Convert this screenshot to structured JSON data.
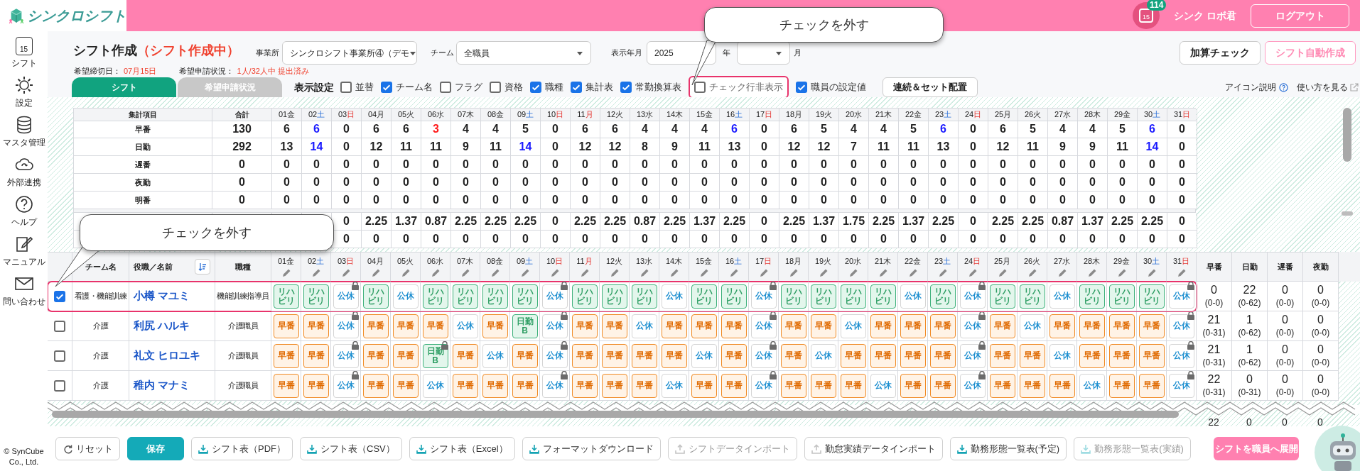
{
  "header": {
    "logo": "シンクロシフト",
    "calendar_day": "15",
    "badge": "114",
    "user": "シンク ロボ君",
    "logout": "ログアウト"
  },
  "sidebar": {
    "items": [
      {
        "label": "シフト",
        "icon_text": "15"
      },
      {
        "label": "設定"
      },
      {
        "label": "マスタ管理"
      },
      {
        "label": "外部連携"
      },
      {
        "label": "ヘルプ"
      },
      {
        "label": "マニュアル"
      },
      {
        "label": "問い合わせ"
      }
    ],
    "copyright": "© SynCube Co., Ltd."
  },
  "title": "シフト作成",
  "status": "（シフト作成中）",
  "filters": {
    "office_label": "事業所",
    "office": "シンクロシフト事業所④（デモ",
    "team_label": "チーム",
    "team": "全職員",
    "period_label": "表示年月",
    "year": "2025",
    "year_unit": "年",
    "month_unit": "月"
  },
  "actions": [
    "加算チェック",
    "シフト自動作成"
  ],
  "deadline": {
    "label": "希望締切日：",
    "value": "07月15日",
    "status_label": "希望申請状況：",
    "status": "1人/32人中 提出済み"
  },
  "tabs": [
    {
      "label": "シフト",
      "selected": true
    },
    {
      "label": "希望申請状況",
      "selected": false
    }
  ],
  "display_settings": {
    "label": "表示設定",
    "options": [
      {
        "label": "並替",
        "checked": false,
        "highlighted": false
      },
      {
        "label": "チーム名",
        "checked": true,
        "highlighted": false
      },
      {
        "label": "フラグ",
        "checked": false,
        "highlighted": false
      },
      {
        "label": "資格",
        "checked": false,
        "highlighted": false
      },
      {
        "label": "職種",
        "checked": true,
        "highlighted": false
      },
      {
        "label": "集計表",
        "checked": true,
        "highlighted": false
      },
      {
        "label": "常勤換算表",
        "checked": true,
        "highlighted": false
      },
      {
        "label": "チェック行非表示",
        "checked": false,
        "highlighted": true
      },
      {
        "label": "職員の設定値",
        "checked": true,
        "highlighted": false
      }
    ],
    "button": "連続＆セット配置"
  },
  "links": [
    "アイコン説明",
    "使い方を見る"
  ],
  "summary": {
    "label_header": "集計項目",
    "total_header": "合計",
    "days": [
      {
        "day": "01",
        "dow": "金",
        "kind": "weekday"
      },
      {
        "day": "02",
        "dow": "土",
        "kind": "sat"
      },
      {
        "day": "03",
        "dow": "日",
        "kind": "sun"
      },
      {
        "day": "04",
        "dow": "月",
        "kind": "weekday"
      },
      {
        "day": "05",
        "dow": "火",
        "kind": "weekday"
      },
      {
        "day": "06",
        "dow": "水",
        "kind": "weekday"
      },
      {
        "day": "07",
        "dow": "木",
        "kind": "weekday"
      },
      {
        "day": "08",
        "dow": "金",
        "kind": "weekday"
      },
      {
        "day": "09",
        "dow": "土",
        "kind": "sat"
      },
      {
        "day": "10",
        "dow": "日",
        "kind": "sun"
      },
      {
        "day": "11",
        "dow": "月",
        "kind": "holiday"
      },
      {
        "day": "12",
        "dow": "火",
        "kind": "weekday"
      },
      {
        "day": "13",
        "dow": "水",
        "kind": "weekday"
      },
      {
        "day": "14",
        "dow": "木",
        "kind": "weekday"
      },
      {
        "day": "15",
        "dow": "金",
        "kind": "weekday"
      },
      {
        "day": "16",
        "dow": "土",
        "kind": "sat"
      },
      {
        "day": "17",
        "dow": "日",
        "kind": "sun"
      },
      {
        "day": "18",
        "dow": "月",
        "kind": "weekday"
      },
      {
        "day": "19",
        "dow": "火",
        "kind": "weekday"
      },
      {
        "day": "20",
        "dow": "水",
        "kind": "weekday"
      },
      {
        "day": "21",
        "dow": "木",
        "kind": "weekday"
      },
      {
        "day": "22",
        "dow": "金",
        "kind": "weekday"
      },
      {
        "day": "23",
        "dow": "土",
        "kind": "sat"
      },
      {
        "day": "24",
        "dow": "日",
        "kind": "sun"
      },
      {
        "day": "25",
        "dow": "月",
        "kind": "weekday"
      },
      {
        "day": "26",
        "dow": "火",
        "kind": "weekday"
      },
      {
        "day": "27",
        "dow": "水",
        "kind": "weekday"
      },
      {
        "day": "28",
        "dow": "木",
        "kind": "weekday"
      },
      {
        "day": "29",
        "dow": "金",
        "kind": "weekday"
      },
      {
        "day": "30",
        "dow": "土",
        "kind": "sat"
      },
      {
        "day": "31",
        "dow": "日",
        "kind": "sun"
      }
    ],
    "rows": [
      {
        "label": "早番",
        "total": "130",
        "values": [
          "6",
          {
            "text": "6",
            "color": "#1a1aff"
          },
          "0",
          "6",
          "6",
          {
            "text": "3",
            "color": "#ff1a1a"
          },
          "4",
          "4",
          "5",
          "0",
          "6",
          "6",
          "4",
          "4",
          "4",
          {
            "text": "6",
            "color": "#1a1aff"
          },
          "0",
          "6",
          "5",
          "4",
          "4",
          "5",
          {
            "text": "6",
            "color": "#1a1aff"
          },
          "0",
          "6",
          "5",
          "4",
          "4",
          "5",
          {
            "text": "6",
            "color": "#1a1aff"
          },
          "0"
        ]
      },
      {
        "label": "日勤",
        "total": "292",
        "values": [
          "13",
          {
            "text": "14",
            "color": "#1a1aff"
          },
          "0",
          "12",
          "11",
          "11",
          "9",
          "11",
          {
            "text": "14",
            "color": "#1a1aff"
          },
          "0",
          "12",
          "12",
          "8",
          "9",
          "11",
          "13",
          "0",
          "12",
          "12",
          "7",
          "11",
          "11",
          "13",
          "0",
          "12",
          "11",
          "9",
          "9",
          "11",
          {
            "text": "14",
            "color": "#1a1aff"
          },
          "0"
        ]
      },
      {
        "label": "遅番",
        "total": "0",
        "values": [
          "0",
          "0",
          "0",
          "0",
          "0",
          "0",
          "0",
          "0",
          "0",
          "0",
          "0",
          "0",
          "0",
          "0",
          "0",
          "0",
          "0",
          "0",
          "0",
          "0",
          "0",
          "0",
          "0",
          "0",
          "0",
          "0",
          "0",
          "0",
          "0",
          "0",
          "0"
        ]
      },
      {
        "label": "夜勤",
        "total": "0",
        "values": [
          "0",
          "0",
          "0",
          "0",
          "0",
          "0",
          "0",
          "0",
          "0",
          "0",
          "0",
          "0",
          "0",
          "0",
          "0",
          "0",
          "0",
          "0",
          "0",
          "0",
          "0",
          "0",
          "0",
          "0",
          "0",
          "0",
          "0",
          "0",
          "0",
          "0",
          "0"
        ]
      },
      {
        "label": "明番",
        "total": "0",
        "values": [
          "0",
          "0",
          "0",
          "0",
          "0",
          "0",
          "0",
          "0",
          "0",
          "0",
          "0",
          "0",
          "0",
          "0",
          "0",
          "0",
          "0",
          "0",
          "0",
          "0",
          "0",
          "0",
          "0",
          "0",
          "0",
          "0",
          "0",
          "0",
          "0",
          "0",
          "0"
        ]
      },
      {
        "values": [
          "0",
          "2.25",
          "1.37",
          "0.87",
          "2.25",
          "2.25",
          "2.25",
          "0",
          "2.25",
          "2.25",
          "0.87",
          "2.25",
          "1.37",
          "2.25",
          "0",
          "2.25",
          "1.37",
          "1.75",
          "2.25",
          "1.37",
          "2.25",
          "0",
          "2.25",
          "2.25",
          "0.87",
          "1.37",
          "2.25",
          "2.25",
          "0"
        ]
      },
      {
        "values": [
          "0",
          "0",
          "0",
          "0",
          "0",
          "0",
          "0",
          "0",
          "0",
          "0",
          "0",
          "0",
          "0",
          "0",
          "0",
          "0",
          "0",
          "0",
          "0",
          "0",
          "0",
          "0",
          "0",
          "0",
          "0",
          "0",
          "0",
          "0",
          "0"
        ]
      }
    ]
  },
  "staff": {
    "headers": {
      "team": "チーム名",
      "name": "役職／名前",
      "job": "職種"
    },
    "count_headers": [
      "早番",
      "日勤",
      "遅番",
      "夜勤"
    ],
    "days": [
      {
        "day": "01",
        "dow": "金",
        "kind": "weekday"
      },
      {
        "day": "02",
        "dow": "土",
        "kind": "sat"
      },
      {
        "day": "03",
        "dow": "日",
        "kind": "sun"
      },
      {
        "day": "04",
        "dow": "月",
        "kind": "weekday"
      },
      {
        "day": "05",
        "dow": "火",
        "kind": "weekday"
      },
      {
        "day": "06",
        "dow": "水",
        "kind": "weekday"
      },
      {
        "day": "07",
        "dow": "木",
        "kind": "weekday"
      },
      {
        "day": "08",
        "dow": "金",
        "kind": "weekday"
      },
      {
        "day": "09",
        "dow": "土",
        "kind": "sat"
      },
      {
        "day": "10",
        "dow": "日",
        "kind": "sun"
      },
      {
        "day": "11",
        "dow": "月",
        "kind": "holiday"
      },
      {
        "day": "12",
        "dow": "火",
        "kind": "weekday"
      },
      {
        "day": "13",
        "dow": "水",
        "kind": "weekday"
      },
      {
        "day": "14",
        "dow": "木",
        "kind": "weekday"
      },
      {
        "day": "15",
        "dow": "金",
        "kind": "weekday"
      },
      {
        "day": "16",
        "dow": "土",
        "kind": "sat"
      },
      {
        "day": "17",
        "dow": "日",
        "kind": "sun"
      },
      {
        "day": "18",
        "dow": "月",
        "kind": "weekday"
      },
      {
        "day": "19",
        "dow": "火",
        "kind": "weekday"
      },
      {
        "day": "20",
        "dow": "水",
        "kind": "weekday"
      },
      {
        "day": "21",
        "dow": "木",
        "kind": "weekday"
      },
      {
        "day": "22",
        "dow": "金",
        "kind": "weekday"
      },
      {
        "day": "23",
        "dow": "土",
        "kind": "sat"
      },
      {
        "day": "24",
        "dow": "日",
        "kind": "sun"
      },
      {
        "day": "25",
        "dow": "月",
        "kind": "weekday"
      },
      {
        "day": "26",
        "dow": "火",
        "kind": "weekday"
      },
      {
        "day": "27",
        "dow": "水",
        "kind": "weekday"
      },
      {
        "day": "28",
        "dow": "木",
        "kind": "weekday"
      },
      {
        "day": "29",
        "dow": "金",
        "kind": "weekday"
      },
      {
        "day": "30",
        "dow": "土",
        "kind": "sat"
      },
      {
        "day": "31",
        "dow": "日",
        "kind": "sun"
      }
    ],
    "rows": [
      {
        "checked": true,
        "highlighted": true,
        "team": "看護・機能訓練",
        "name": "小樽 マユミ",
        "job": "機能訓練指導員",
        "shifts": [
          {
            "kind": "riha",
            "text": "リハビリ",
            "locked": false
          },
          {
            "kind": "riha",
            "text": "リハビリ",
            "locked": false
          },
          {
            "kind": "off",
            "text": "公休",
            "locked": true
          },
          {
            "kind": "riha",
            "text": "リハビリ",
            "locked": false
          },
          {
            "kind": "off",
            "text": "公休",
            "locked": false
          },
          {
            "kind": "riha",
            "text": "リハビリ",
            "locked": false
          },
          {
            "kind": "riha",
            "text": "リハビリ",
            "locked": false
          },
          {
            "kind": "riha",
            "text": "リハビリ",
            "locked": false
          },
          {
            "kind": "riha",
            "text": "リハビリ",
            "locked": false
          },
          {
            "kind": "off",
            "text": "公休",
            "locked": true
          },
          {
            "kind": "riha",
            "text": "リハビリ",
            "locked": false
          },
          {
            "kind": "riha",
            "text": "リハビリ",
            "locked": false
          },
          {
            "kind": "riha",
            "text": "リハビリ",
            "locked": false
          },
          {
            "kind": "off",
            "text": "公休",
            "locked": false
          },
          {
            "kind": "riha",
            "text": "リハビリ",
            "locked": false
          },
          {
            "kind": "riha",
            "text": "リハビリ",
            "locked": false
          },
          {
            "kind": "off",
            "text": "公休",
            "locked": true
          },
          {
            "kind": "riha",
            "text": "リハビリ",
            "locked": false
          },
          {
            "kind": "riha",
            "text": "リハビリ",
            "locked": false
          },
          {
            "kind": "riha",
            "text": "リハビリ",
            "locked": false
          },
          {
            "kind": "riha",
            "text": "リハビリ",
            "locked": false
          },
          {
            "kind": "off",
            "text": "公休",
            "locked": false
          },
          {
            "kind": "riha",
            "text": "リハビリ",
            "locked": false
          },
          {
            "kind": "off",
            "text": "公休",
            "locked": true
          },
          {
            "kind": "riha",
            "text": "リハビリ",
            "locked": false
          },
          {
            "kind": "riha",
            "text": "リハビリ",
            "locked": false
          },
          {
            "kind": "off",
            "text": "公休",
            "locked": false
          },
          {
            "kind": "riha",
            "text": "リハビリ",
            "locked": false
          },
          {
            "kind": "riha",
            "text": "リハビリ",
            "locked": false
          },
          {
            "kind": "riha",
            "text": "リハビリ",
            "locked": false
          },
          {
            "kind": "off",
            "text": "公休",
            "locked": true
          }
        ],
        "counts": [
          {
            "value": "0",
            "range": "(0-0)"
          },
          {
            "value": "22",
            "range": "(0-62)"
          },
          {
            "value": "0",
            "range": "(0-0)"
          },
          {
            "value": "0",
            "range": "(0-0)"
          }
        ]
      },
      {
        "checked": false,
        "highlighted": false,
        "team": "介護",
        "name": "利尻 ハルキ",
        "job": "介護職員",
        "shifts": [
          {
            "kind": "early",
            "text": "早番",
            "locked": false
          },
          {
            "kind": "early",
            "text": "早番",
            "locked": false
          },
          {
            "kind": "off",
            "text": "公休",
            "locked": true
          },
          {
            "kind": "early",
            "text": "早番",
            "locked": false
          },
          {
            "kind": "early",
            "text": "早番",
            "locked": false
          },
          {
            "kind": "early",
            "text": "早番",
            "locked": false
          },
          {
            "kind": "off",
            "text": "公休",
            "locked": false
          },
          {
            "kind": "early",
            "text": "早番",
            "locked": false
          },
          {
            "kind": "day",
            "text": "日勤B",
            "locked": false
          },
          {
            "kind": "off",
            "text": "公休",
            "locked": true
          },
          {
            "kind": "early",
            "text": "早番",
            "locked": false
          },
          {
            "kind": "early",
            "text": "早番",
            "locked": false
          },
          {
            "kind": "off",
            "text": "公休",
            "locked": false
          },
          {
            "kind": "early",
            "text": "早番",
            "locked": false
          },
          {
            "kind": "early",
            "text": "早番",
            "locked": false
          },
          {
            "kind": "early",
            "text": "早番",
            "locked": false
          },
          {
            "kind": "off",
            "text": "公休",
            "locked": true
          },
          {
            "kind": "early",
            "text": "早番",
            "locked": false
          },
          {
            "kind": "early",
            "text": "早番",
            "locked": false
          },
          {
            "kind": "off",
            "text": "公休",
            "locked": false
          },
          {
            "kind": "early",
            "text": "早番",
            "locked": false
          },
          {
            "kind": "early",
            "text": "早番",
            "locked": false
          },
          {
            "kind": "early",
            "text": "早番",
            "locked": false
          },
          {
            "kind": "off",
            "text": "公休",
            "locked": true
          },
          {
            "kind": "early",
            "text": "早番",
            "locked": false
          },
          {
            "kind": "off",
            "text": "公休",
            "locked": false
          },
          {
            "kind": "early",
            "text": "早番",
            "locked": false
          },
          {
            "kind": "early",
            "text": "早番",
            "locked": false
          },
          {
            "kind": "early",
            "text": "早番",
            "locked": false
          },
          {
            "kind": "early",
            "text": "早番",
            "locked": false
          },
          {
            "kind": "off",
            "text": "公休",
            "locked": true
          }
        ],
        "counts": [
          {
            "value": "21",
            "range": "(0-31)"
          },
          {
            "value": "1",
            "range": "(0-62)"
          },
          {
            "value": "0",
            "range": "(0-0)"
          },
          {
            "value": "0",
            "range": "(0-0)"
          }
        ]
      },
      {
        "checked": false,
        "highlighted": false,
        "team": "介護",
        "name": "礼文 ヒロユキ",
        "job": "介護職員",
        "shifts": [
          {
            "kind": "early",
            "text": "早番",
            "locked": false
          },
          {
            "kind": "early",
            "text": "早番",
            "locked": false
          },
          {
            "kind": "off",
            "text": "公休",
            "locked": true
          },
          {
            "kind": "early",
            "text": "早番",
            "locked": false
          },
          {
            "kind": "early",
            "text": "早番",
            "locked": false
          },
          {
            "kind": "day",
            "text": "日勤B",
            "locked": true
          },
          {
            "kind": "early",
            "text": "早番",
            "locked": false
          },
          {
            "kind": "off",
            "text": "公休",
            "locked": false
          },
          {
            "kind": "early",
            "text": "早番",
            "locked": false
          },
          {
            "kind": "off",
            "text": "公休",
            "locked": true
          },
          {
            "kind": "early",
            "text": "早番",
            "locked": false
          },
          {
            "kind": "early",
            "text": "早番",
            "locked": false
          },
          {
            "kind": "early",
            "text": "早番",
            "locked": false
          },
          {
            "kind": "early",
            "text": "早番",
            "locked": false
          },
          {
            "kind": "off",
            "text": "公休",
            "locked": false
          },
          {
            "kind": "early",
            "text": "早番",
            "locked": false
          },
          {
            "kind": "off",
            "text": "公休",
            "locked": true
          },
          {
            "kind": "early",
            "text": "早番",
            "locked": false
          },
          {
            "kind": "off",
            "text": "公休",
            "locked": false
          },
          {
            "kind": "early",
            "text": "早番",
            "locked": false
          },
          {
            "kind": "early",
            "text": "早番",
            "locked": false
          },
          {
            "kind": "early",
            "text": "早番",
            "locked": false
          },
          {
            "kind": "early",
            "text": "早番",
            "locked": false
          },
          {
            "kind": "off",
            "text": "公休",
            "locked": true
          },
          {
            "kind": "early",
            "text": "早番",
            "locked": false
          },
          {
            "kind": "early",
            "text": "早番",
            "locked": false
          },
          {
            "kind": "off",
            "text": "公休",
            "locked": false
          },
          {
            "kind": "early",
            "text": "早番",
            "locked": false
          },
          {
            "kind": "early",
            "text": "早番",
            "locked": false
          },
          {
            "kind": "early",
            "text": "早番",
            "locked": false
          },
          {
            "kind": "off",
            "text": "公休",
            "locked": true
          }
        ],
        "counts": [
          {
            "value": "21",
            "range": "(0-31)"
          },
          {
            "value": "1",
            "range": "(0-62)"
          },
          {
            "value": "0",
            "range": "(0-0)"
          },
          {
            "value": "0",
            "range": "(0-0)"
          }
        ]
      },
      {
        "checked": false,
        "highlighted": false,
        "team": "介護",
        "name": "稚内 マナミ",
        "job": "介護職員",
        "shifts": [
          {
            "kind": "early",
            "text": "早番",
            "locked": false
          },
          {
            "kind": "early",
            "text": "早番",
            "locked": false
          },
          {
            "kind": "off",
            "text": "公休",
            "locked": true
          },
          {
            "kind": "early",
            "text": "早番",
            "locked": false
          },
          {
            "kind": "early",
            "text": "早番",
            "locked": false
          },
          {
            "kind": "off",
            "text": "公休",
            "locked": false
          },
          {
            "kind": "early",
            "text": "早番",
            "locked": false
          },
          {
            "kind": "early",
            "text": "早番",
            "locked": false
          },
          {
            "kind": "early",
            "text": "早番",
            "locked": false
          },
          {
            "kind": "off",
            "text": "公休",
            "locked": true
          },
          {
            "kind": "early",
            "text": "早番",
            "locked": false
          },
          {
            "kind": "early",
            "text": "早番",
            "locked": false
          },
          {
            "kind": "early",
            "text": "早番",
            "locked": false
          },
          {
            "kind": "off",
            "text": "公休",
            "locked": false
          },
          {
            "kind": "early",
            "text": "早番",
            "locked": false
          },
          {
            "kind": "early",
            "text": "早番",
            "locked": false
          },
          {
            "kind": "off",
            "text": "公休",
            "locked": true
          },
          {
            "kind": "early",
            "text": "早番",
            "locked": false
          },
          {
            "kind": "early",
            "text": "早番",
            "locked": false
          },
          {
            "kind": "early",
            "text": "早番",
            "locked": false
          },
          {
            "kind": "off",
            "text": "公休",
            "locked": false
          },
          {
            "kind": "early",
            "text": "早番",
            "locked": false
          },
          {
            "kind": "early",
            "text": "早番",
            "locked": false
          },
          {
            "kind": "off",
            "text": "公休",
            "locked": true
          },
          {
            "kind": "early",
            "text": "早番",
            "locked": false
          },
          {
            "kind": "early",
            "text": "早番",
            "locked": false
          },
          {
            "kind": "early",
            "text": "早番",
            "locked": false
          },
          {
            "kind": "off",
            "text": "公休",
            "locked": false
          },
          {
            "kind": "early",
            "text": "早番",
            "locked": false
          },
          {
            "kind": "early",
            "text": "早番",
            "locked": false
          },
          {
            "kind": "off",
            "text": "公休",
            "locked": true
          }
        ],
        "counts": [
          {
            "value": "22",
            "range": "(0-31)"
          },
          {
            "value": "0",
            "range": "(0-31)"
          },
          {
            "value": "0",
            "range": "(0-0)"
          },
          {
            "value": "0",
            "range": "(0-0)"
          }
        ]
      }
    ],
    "partial_row_counts": [
      "22",
      "0",
      "0",
      "0"
    ]
  },
  "footer_buttons": [
    {
      "label": "リセット",
      "kind": "reset",
      "disabled": false
    },
    {
      "label": "保存",
      "kind": "save",
      "disabled": false
    },
    {
      "label": "シフト表（PDF）",
      "kind": "download",
      "disabled": false
    },
    {
      "label": "シフト表（CSV）",
      "kind": "download",
      "disabled": false
    },
    {
      "label": "シフト表（Excel）",
      "kind": "download",
      "disabled": false
    },
    {
      "label": "フォーマットダウンロード",
      "kind": "download",
      "disabled": false
    },
    {
      "label": "シフトデータインポート",
      "kind": "upload",
      "disabled": true
    },
    {
      "label": "勤怠実績データインポート",
      "kind": "upload",
      "disabled": false
    },
    {
      "label": "勤務形態一覧表(予定)",
      "kind": "download",
      "disabled": false
    },
    {
      "label": "勤務形態一覧表(実績)",
      "kind": "download",
      "disabled": true
    }
  ],
  "publish_button": "シフトを職員へ展開",
  "callouts": [
    {
      "text": "チェックを外す"
    },
    {
      "text": "チェックを外す"
    }
  ]
}
